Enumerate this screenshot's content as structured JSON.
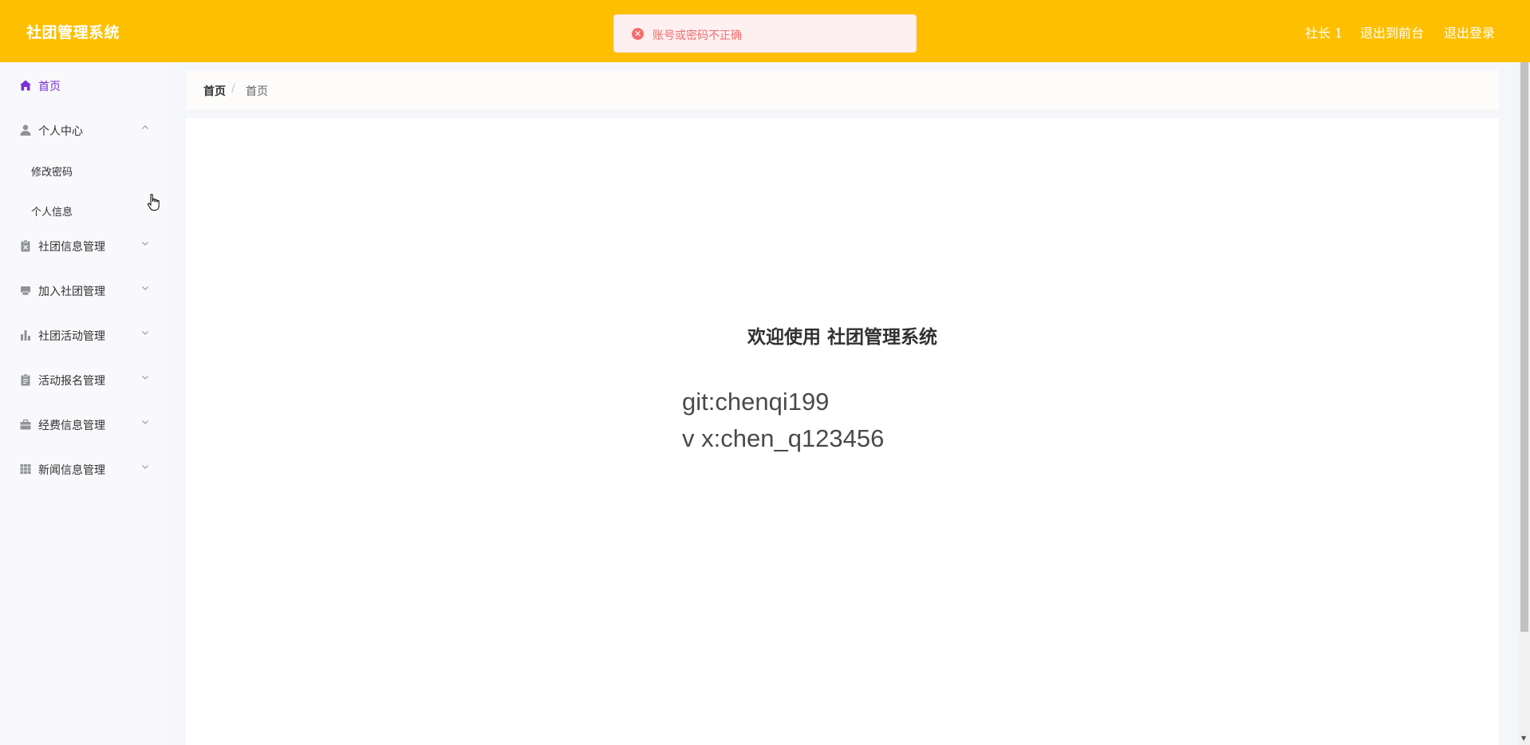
{
  "header": {
    "title": "社团管理系统",
    "user": "社长 1",
    "front_link": "退出到前台",
    "logout_link": "退出登录",
    "bg_color": "#fdbf00"
  },
  "toast": {
    "type": "error",
    "message": "账号或密码不正确"
  },
  "sidebar": {
    "items": [
      {
        "label": "首页",
        "icon": "home-icon",
        "active": true
      },
      {
        "label": "个人中心",
        "icon": "user-icon",
        "expanded": true,
        "children": [
          "修改密码",
          "个人信息"
        ]
      },
      {
        "label": "社团信息管理",
        "icon": "clipboard-x-icon"
      },
      {
        "label": "加入社团管理",
        "icon": "printer-icon"
      },
      {
        "label": "社团活动管理",
        "icon": "bar-chart-icon"
      },
      {
        "label": "活动报名管理",
        "icon": "clipboard-icon"
      },
      {
        "label": "经费信息管理",
        "icon": "briefcase-icon"
      },
      {
        "label": "新闻信息管理",
        "icon": "grid-icon"
      }
    ],
    "active_color": "#7b2fd8"
  },
  "breadcrumb": [
    "首页",
    "首页"
  ],
  "main": {
    "welcome": "欢迎使用 社团管理系统",
    "lines": [
      "git:chenqi199",
      "v x:chen_q123456"
    ]
  }
}
